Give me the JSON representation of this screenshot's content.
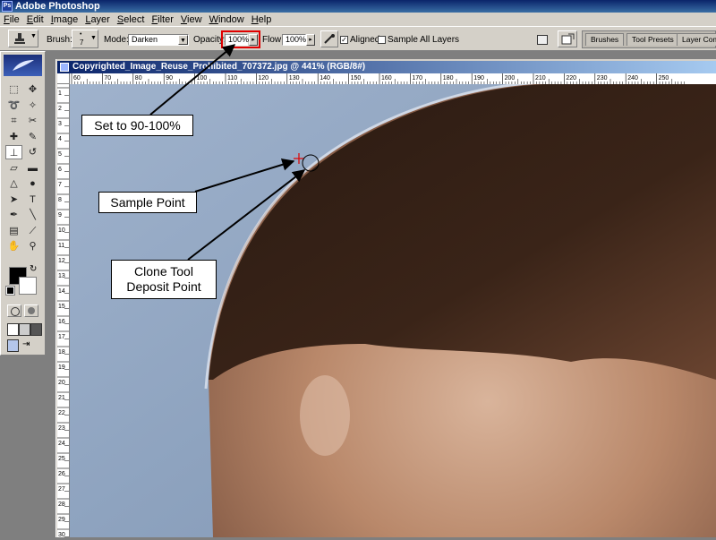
{
  "app": {
    "title": "Adobe Photoshop"
  },
  "menu": [
    {
      "label": "File",
      "u": "F",
      "rest": "ile"
    },
    {
      "label": "Edit",
      "u": "E",
      "rest": "dit"
    },
    {
      "label": "Image",
      "u": "I",
      "rest": "mage"
    },
    {
      "label": "Layer",
      "u": "L",
      "rest": "ayer"
    },
    {
      "label": "Select",
      "u": "S",
      "rest": "elect"
    },
    {
      "label": "Filter",
      "u": "F",
      "rest": "ilter"
    },
    {
      "label": "View",
      "u": "V",
      "rest": "iew"
    },
    {
      "label": "Window",
      "u": "W",
      "rest": "indow"
    },
    {
      "label": "Help",
      "u": "H",
      "rest": "elp"
    }
  ],
  "options": {
    "brush_label": "Brush:",
    "brush_size": "7",
    "mode_label": "Mode:",
    "mode_value": "Darken",
    "opacity_label": "Opacity:",
    "opacity_value": "100%",
    "flow_label": "Flow:",
    "flow_value": "100%",
    "aligned_label": "Aligned",
    "aligned_checked": true,
    "sample_all_label": "Sample All Layers",
    "sample_all_checked": false
  },
  "palette_tabs": [
    "Brushes",
    "Tool Presets",
    "Layer Com"
  ],
  "document": {
    "title": "Copyrighted_Image_Reuse_Prohibited_707372.jpg @ 441% (RGB/8#)",
    "ruler_h_labels": [
      "60",
      "70",
      "80",
      "90",
      "100",
      "110",
      "120",
      "130",
      "140",
      "150",
      "160",
      "170",
      "180",
      "190",
      "200",
      "210",
      "220",
      "230",
      "240",
      "250"
    ],
    "ruler_v_labels": [
      "1",
      "2",
      "3",
      "4",
      "5",
      "6",
      "7",
      "8",
      "9",
      "10",
      "11",
      "12",
      "13",
      "14",
      "15",
      "16",
      "17",
      "18",
      "19",
      "20",
      "21",
      "22",
      "23",
      "24",
      "25",
      "26",
      "27",
      "28",
      "29",
      "30",
      "31"
    ]
  },
  "callouts": {
    "opacity_note": "Set to 90-100%",
    "sample_point": "Sample Point",
    "deposit_point_line1": "Clone Tool",
    "deposit_point_line2": "Deposit Point"
  },
  "colors": {
    "accent_highlight": "#e00000",
    "foreground_swatch": "#000000",
    "background_swatch": "#ffffff"
  }
}
